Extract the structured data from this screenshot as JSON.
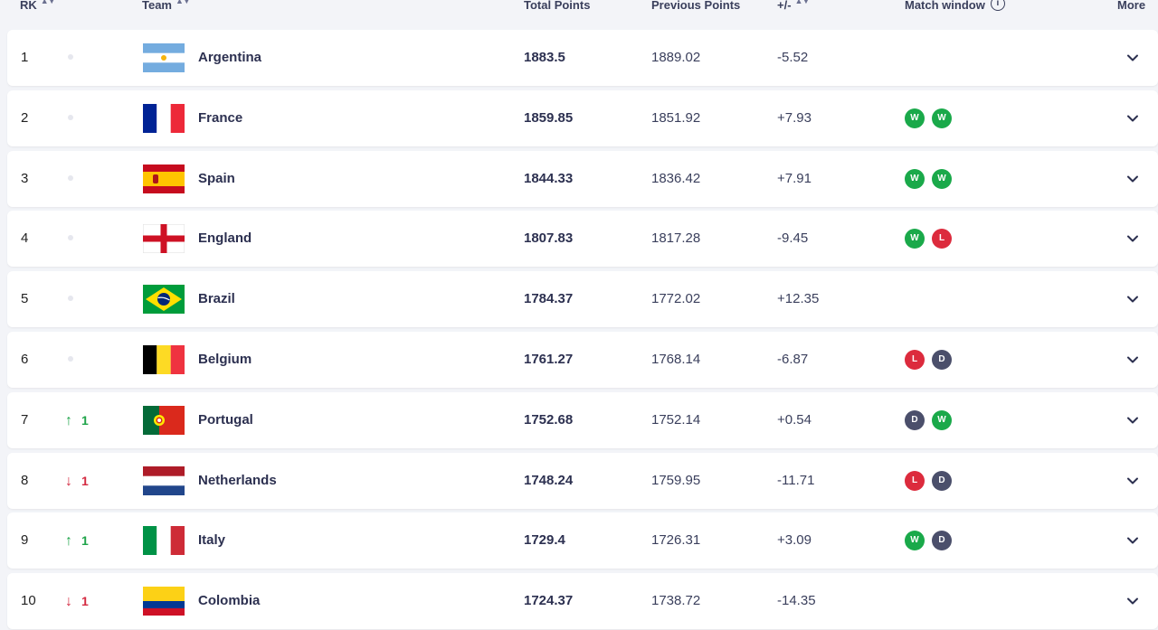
{
  "header": {
    "rank": "RK",
    "team": "Team",
    "total": "Total Points",
    "previous": "Previous Points",
    "diff": "+/-",
    "window": "Match window",
    "more": "More"
  },
  "colors": {
    "win": "#1aa94a",
    "loss": "#dc2b3d",
    "draw": "#4b4f6b",
    "up": "#1fa44a",
    "down": "#d42b42"
  },
  "rows": [
    {
      "rank": "1",
      "move": "none",
      "move_value": "",
      "team": "Argentina",
      "flag": "argentina-flag",
      "total": "1883.5",
      "previous": "1889.02",
      "diff": "-5.52",
      "window": []
    },
    {
      "rank": "2",
      "move": "none",
      "move_value": "",
      "team": "France",
      "flag": "france-flag",
      "total": "1859.85",
      "previous": "1851.92",
      "diff": "+7.93",
      "window": [
        "W",
        "W"
      ]
    },
    {
      "rank": "3",
      "move": "none",
      "move_value": "",
      "team": "Spain",
      "flag": "spain-flag",
      "total": "1844.33",
      "previous": "1836.42",
      "diff": "+7.91",
      "window": [
        "W",
        "W"
      ]
    },
    {
      "rank": "4",
      "move": "none",
      "move_value": "",
      "team": "England",
      "flag": "england-flag",
      "total": "1807.83",
      "previous": "1817.28",
      "diff": "-9.45",
      "window": [
        "W",
        "L"
      ]
    },
    {
      "rank": "5",
      "move": "none",
      "move_value": "",
      "team": "Brazil",
      "flag": "brazil-flag",
      "total": "1784.37",
      "previous": "1772.02",
      "diff": "+12.35",
      "window": []
    },
    {
      "rank": "6",
      "move": "none",
      "move_value": "",
      "team": "Belgium",
      "flag": "belgium-flag",
      "total": "1761.27",
      "previous": "1768.14",
      "diff": "-6.87",
      "window": [
        "L",
        "D"
      ]
    },
    {
      "rank": "7",
      "move": "up",
      "move_value": "1",
      "team": "Portugal",
      "flag": "portugal-flag",
      "total": "1752.68",
      "previous": "1752.14",
      "diff": "+0.54",
      "window": [
        "D",
        "W"
      ]
    },
    {
      "rank": "8",
      "move": "down",
      "move_value": "1",
      "team": "Netherlands",
      "flag": "netherlands-flag",
      "total": "1748.24",
      "previous": "1759.95",
      "diff": "-11.71",
      "window": [
        "L",
        "D"
      ]
    },
    {
      "rank": "9",
      "move": "up",
      "move_value": "1",
      "team": "Italy",
      "flag": "italy-flag",
      "total": "1729.4",
      "previous": "1726.31",
      "diff": "+3.09",
      "window": [
        "W",
        "D"
      ]
    },
    {
      "rank": "10",
      "move": "down",
      "move_value": "1",
      "team": "Colombia",
      "flag": "colombia-flag",
      "total": "1724.37",
      "previous": "1738.72",
      "diff": "-14.35",
      "window": []
    }
  ]
}
